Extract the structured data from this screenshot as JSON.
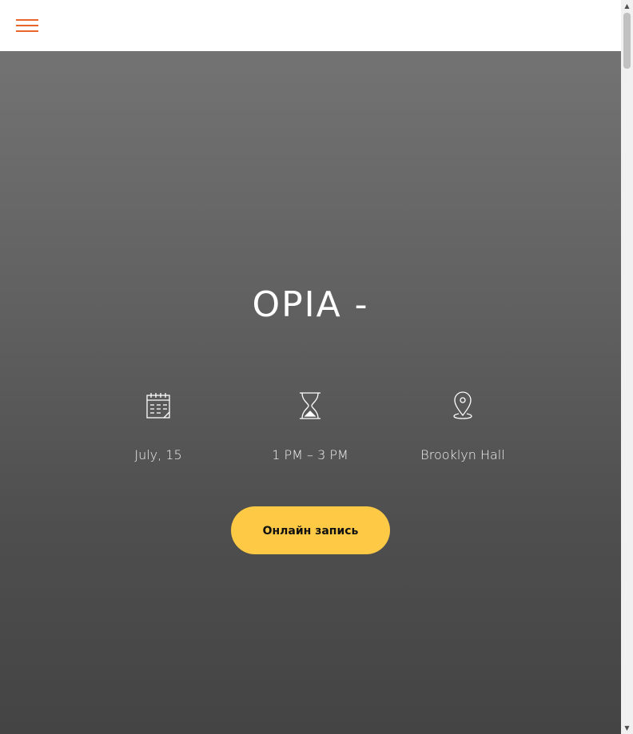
{
  "header": {
    "menu_icon": "hamburger-menu-icon",
    "accent_color": "#e8672c"
  },
  "hero": {
    "title": "OPIA -",
    "info": [
      {
        "icon": "calendar-icon",
        "label": "July, 15"
      },
      {
        "icon": "hourglass-icon",
        "label": "1 PM – 3 PM"
      },
      {
        "icon": "map-pin-icon",
        "label": "Brooklyn Hall"
      }
    ],
    "cta_label": "Онлайн запись",
    "cta_color": "#fec944"
  },
  "scrollbar": {
    "up_arrow": "▲",
    "down_arrow": "▼"
  }
}
